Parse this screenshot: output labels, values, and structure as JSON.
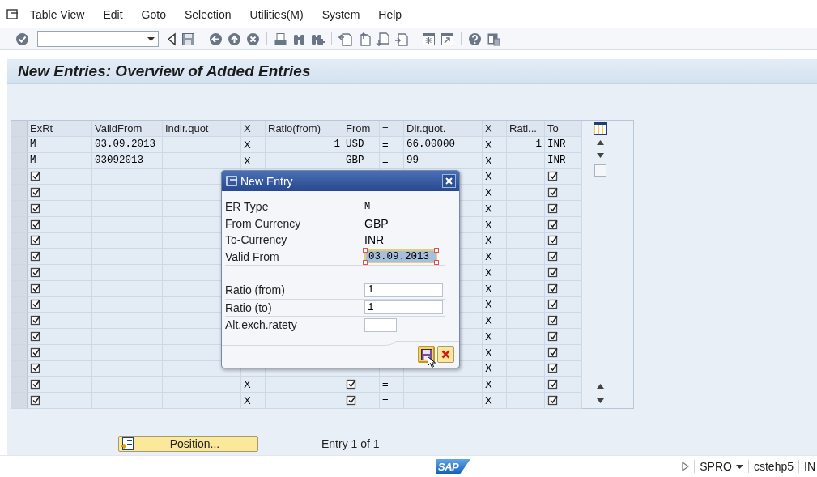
{
  "menu": {
    "items": [
      "Table View",
      "Edit",
      "Goto",
      "Selection",
      "Utilities(M)",
      "System",
      "Help"
    ]
  },
  "title": "New Entries: Overview of Added Entries",
  "table": {
    "columns": [
      "ExRt",
      "ValidFrom",
      "Indir.quot",
      "X",
      "Ratio(from)",
      "From",
      "=",
      "Dir.quot.",
      "X",
      "Rati...",
      "To"
    ],
    "rows": [
      {
        "cells": [
          {
            "kind": "text",
            "text": "M"
          },
          {
            "kind": "text",
            "text": "03.09.2013"
          },
          {
            "kind": "empty"
          },
          {
            "kind": "text",
            "text": "X"
          },
          {
            "kind": "text",
            "text": "1"
          },
          {
            "kind": "text",
            "text": "USD"
          },
          {
            "kind": "text",
            "text": "="
          },
          {
            "kind": "text",
            "text": "66.00000"
          },
          {
            "kind": "text",
            "text": "X"
          },
          {
            "kind": "text",
            "text": "1"
          },
          {
            "kind": "text",
            "text": "INR"
          }
        ]
      },
      {
        "cells": [
          {
            "kind": "text",
            "text": "M"
          },
          {
            "kind": "text",
            "text": "03092013"
          },
          {
            "kind": "empty"
          },
          {
            "kind": "text",
            "text": "X"
          },
          {
            "kind": "empty"
          },
          {
            "kind": "text",
            "text": "GBP"
          },
          {
            "kind": "text",
            "text": "="
          },
          {
            "kind": "text",
            "text": "99"
          },
          {
            "kind": "text",
            "text": "X"
          },
          {
            "kind": "empty"
          },
          {
            "kind": "text",
            "text": "INR"
          }
        ]
      },
      {
        "cells": [
          {
            "kind": "icon"
          },
          {
            "kind": "empty"
          },
          {
            "kind": "empty"
          },
          {
            "kind": "covered"
          },
          {
            "kind": "covered"
          },
          {
            "kind": "covered"
          },
          {
            "kind": "covered"
          },
          {
            "kind": "empty"
          },
          {
            "kind": "text",
            "text": "X"
          },
          {
            "kind": "empty"
          },
          {
            "kind": "icon"
          }
        ]
      },
      {
        "cells": [
          {
            "kind": "icon"
          },
          {
            "kind": "empty"
          },
          {
            "kind": "empty"
          },
          {
            "kind": "covered"
          },
          {
            "kind": "covered"
          },
          {
            "kind": "covered"
          },
          {
            "kind": "covered"
          },
          {
            "kind": "empty"
          },
          {
            "kind": "text",
            "text": "X"
          },
          {
            "kind": "empty"
          },
          {
            "kind": "icon"
          }
        ]
      },
      {
        "cells": [
          {
            "kind": "icon"
          },
          {
            "kind": "empty"
          },
          {
            "kind": "empty"
          },
          {
            "kind": "covered"
          },
          {
            "kind": "covered"
          },
          {
            "kind": "covered"
          },
          {
            "kind": "covered"
          },
          {
            "kind": "empty"
          },
          {
            "kind": "text",
            "text": "X"
          },
          {
            "kind": "empty"
          },
          {
            "kind": "icon"
          }
        ]
      },
      {
        "cells": [
          {
            "kind": "icon"
          },
          {
            "kind": "empty"
          },
          {
            "kind": "empty"
          },
          {
            "kind": "covered"
          },
          {
            "kind": "covered"
          },
          {
            "kind": "covered"
          },
          {
            "kind": "covered"
          },
          {
            "kind": "empty"
          },
          {
            "kind": "text",
            "text": "X"
          },
          {
            "kind": "empty"
          },
          {
            "kind": "icon"
          }
        ]
      },
      {
        "cells": [
          {
            "kind": "icon"
          },
          {
            "kind": "empty"
          },
          {
            "kind": "empty"
          },
          {
            "kind": "covered"
          },
          {
            "kind": "covered"
          },
          {
            "kind": "covered"
          },
          {
            "kind": "covered"
          },
          {
            "kind": "empty"
          },
          {
            "kind": "text",
            "text": "X"
          },
          {
            "kind": "empty"
          },
          {
            "kind": "icon"
          }
        ]
      },
      {
        "cells": [
          {
            "kind": "icon"
          },
          {
            "kind": "empty"
          },
          {
            "kind": "empty"
          },
          {
            "kind": "covered"
          },
          {
            "kind": "covered"
          },
          {
            "kind": "covered"
          },
          {
            "kind": "covered"
          },
          {
            "kind": "empty"
          },
          {
            "kind": "text",
            "text": "X"
          },
          {
            "kind": "empty"
          },
          {
            "kind": "icon"
          }
        ]
      },
      {
        "cells": [
          {
            "kind": "icon"
          },
          {
            "kind": "empty"
          },
          {
            "kind": "empty"
          },
          {
            "kind": "covered"
          },
          {
            "kind": "covered"
          },
          {
            "kind": "covered"
          },
          {
            "kind": "covered"
          },
          {
            "kind": "empty"
          },
          {
            "kind": "text",
            "text": "X"
          },
          {
            "kind": "empty"
          },
          {
            "kind": "icon"
          }
        ]
      },
      {
        "cells": [
          {
            "kind": "icon"
          },
          {
            "kind": "empty"
          },
          {
            "kind": "empty"
          },
          {
            "kind": "covered"
          },
          {
            "kind": "covered"
          },
          {
            "kind": "covered"
          },
          {
            "kind": "covered"
          },
          {
            "kind": "empty"
          },
          {
            "kind": "text",
            "text": "X"
          },
          {
            "kind": "empty"
          },
          {
            "kind": "icon"
          }
        ]
      },
      {
        "cells": [
          {
            "kind": "icon"
          },
          {
            "kind": "empty"
          },
          {
            "kind": "empty"
          },
          {
            "kind": "covered"
          },
          {
            "kind": "covered"
          },
          {
            "kind": "covered"
          },
          {
            "kind": "covered"
          },
          {
            "kind": "empty"
          },
          {
            "kind": "text",
            "text": "X"
          },
          {
            "kind": "empty"
          },
          {
            "kind": "icon"
          }
        ]
      },
      {
        "cells": [
          {
            "kind": "icon"
          },
          {
            "kind": "empty"
          },
          {
            "kind": "empty"
          },
          {
            "kind": "covered"
          },
          {
            "kind": "covered"
          },
          {
            "kind": "covered"
          },
          {
            "kind": "covered"
          },
          {
            "kind": "empty"
          },
          {
            "kind": "text",
            "text": "X"
          },
          {
            "kind": "empty"
          },
          {
            "kind": "icon"
          }
        ]
      },
      {
        "cells": [
          {
            "kind": "icon"
          },
          {
            "kind": "empty"
          },
          {
            "kind": "empty"
          },
          {
            "kind": "covered"
          },
          {
            "kind": "covered"
          },
          {
            "kind": "covered"
          },
          {
            "kind": "covered"
          },
          {
            "kind": "empty"
          },
          {
            "kind": "text",
            "text": "X"
          },
          {
            "kind": "empty"
          },
          {
            "kind": "icon"
          }
        ]
      },
      {
        "cells": [
          {
            "kind": "icon"
          },
          {
            "kind": "empty"
          },
          {
            "kind": "empty"
          },
          {
            "kind": "covered"
          },
          {
            "kind": "covered"
          },
          {
            "kind": "covered"
          },
          {
            "kind": "covered"
          },
          {
            "kind": "empty"
          },
          {
            "kind": "text",
            "text": "X"
          },
          {
            "kind": "empty"
          },
          {
            "kind": "icon"
          }
        ]
      },
      {
        "cells": [
          {
            "kind": "icon"
          },
          {
            "kind": "empty"
          },
          {
            "kind": "empty"
          },
          {
            "kind": "empty"
          },
          {
            "kind": "empty"
          },
          {
            "kind": "empty"
          },
          {
            "kind": "empty"
          },
          {
            "kind": "empty"
          },
          {
            "kind": "text",
            "text": "X"
          },
          {
            "kind": "empty"
          },
          {
            "kind": "icon"
          }
        ]
      },
      {
        "cells": [
          {
            "kind": "icon"
          },
          {
            "kind": "empty"
          },
          {
            "kind": "empty"
          },
          {
            "kind": "text",
            "text": "X"
          },
          {
            "kind": "empty"
          },
          {
            "kind": "icon"
          },
          {
            "kind": "text",
            "text": "="
          },
          {
            "kind": "empty"
          },
          {
            "kind": "text",
            "text": "X"
          },
          {
            "kind": "empty"
          },
          {
            "kind": "icon"
          }
        ]
      },
      {
        "cells": [
          {
            "kind": "icon"
          },
          {
            "kind": "empty"
          },
          {
            "kind": "empty"
          },
          {
            "kind": "text",
            "text": "X"
          },
          {
            "kind": "empty"
          },
          {
            "kind": "icon"
          },
          {
            "kind": "text",
            "text": "="
          },
          {
            "kind": "empty"
          },
          {
            "kind": "text",
            "text": "X"
          },
          {
            "kind": "empty"
          },
          {
            "kind": "icon"
          }
        ]
      }
    ]
  },
  "position_button": "Position...",
  "entry_info": "Entry 1 of 1",
  "dialog": {
    "title": "New Entry",
    "fields": [
      {
        "kind": "display",
        "label": "ER Type",
        "value": "M"
      },
      {
        "kind": "display",
        "label": "From Currency",
        "value": "GBP"
      },
      {
        "kind": "display",
        "label": "To-Currency",
        "value": "INR"
      },
      {
        "kind": "input",
        "label": "Valid From",
        "value": "03.09.2013",
        "selected": true
      },
      {
        "kind": "gap"
      },
      {
        "kind": "input",
        "label": "Ratio (from)",
        "value": "1",
        "selected": false
      },
      {
        "kind": "input",
        "label": "Ratio (to)",
        "value": "1",
        "selected": false
      },
      {
        "kind": "small-input",
        "label": "Alt.exch.ratety",
        "selected": false
      }
    ]
  },
  "status_bar": {
    "logo": "SAP",
    "transaction": "SPRO",
    "system": "cstehp5",
    "mode": "IN"
  }
}
